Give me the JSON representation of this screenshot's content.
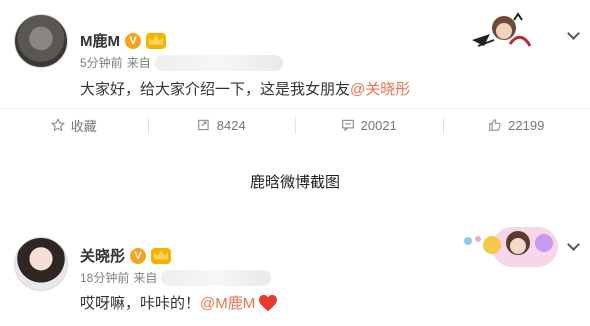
{
  "post1": {
    "user_name": "M鹿M",
    "vip_level": "V",
    "time": "5分钟前",
    "source_prefix": "来自",
    "text": "大家好，给大家介绍一下，这是我女朋友",
    "mention": "@关晓彤",
    "actions": {
      "favorite_label": "收藏",
      "repost_count": "8424",
      "comment_count": "20021",
      "like_count": "22199"
    }
  },
  "caption": "鹿晗微博截图",
  "post2": {
    "user_name": "关晓彤",
    "vip_level": "V",
    "time": "18分钟前",
    "source_prefix": "来自",
    "text": "哎呀嘛，咔咔的！",
    "mention": "@M鹿M"
  },
  "colors": {
    "mention": "#eb7350",
    "vip_badge": "#f7a21b",
    "heart": "#e8392e"
  }
}
